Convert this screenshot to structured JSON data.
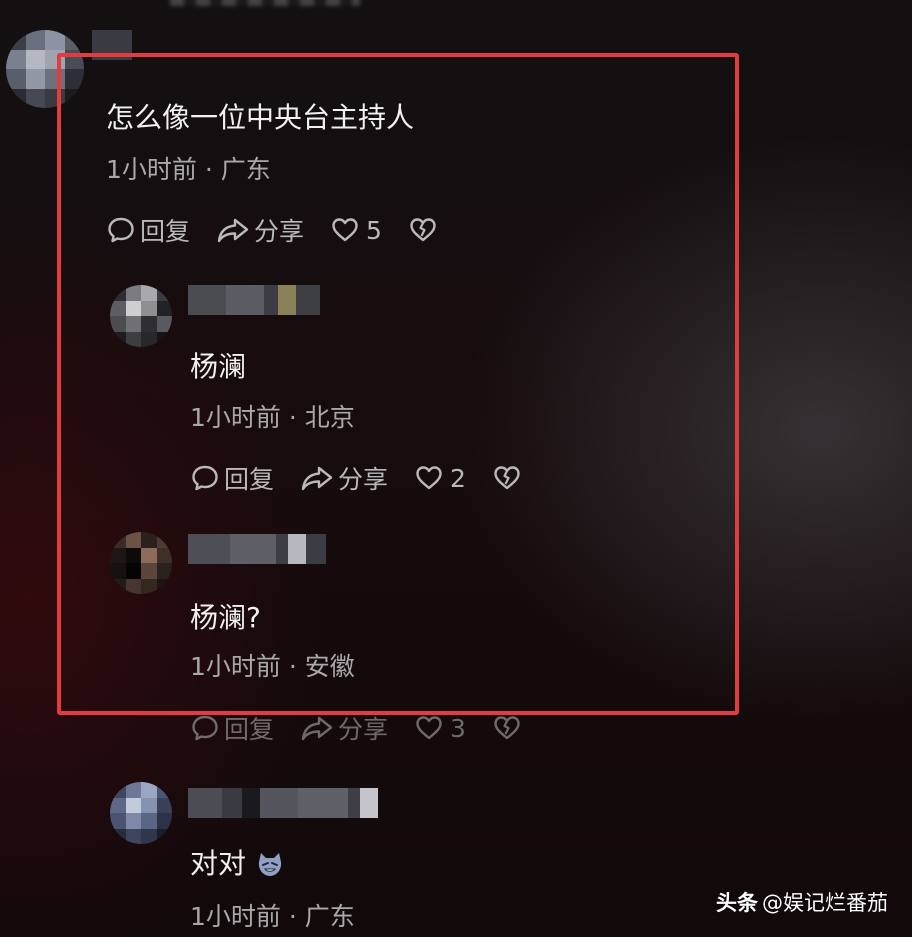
{
  "comments": [
    {
      "text": "怎么像一位中央台主持人",
      "meta": "1小时前 · 广东",
      "reply_label": "回复",
      "share_label": "分享",
      "likes": "5"
    },
    {
      "text": "杨澜",
      "meta": "1小时前 · 北京",
      "reply_label": "回复",
      "share_label": "分享",
      "likes": "2"
    },
    {
      "text": "杨澜?",
      "meta": "1小时前 · 安徽",
      "reply_label": "回复",
      "share_label": "分享",
      "likes": "3"
    },
    {
      "text": "对对",
      "meta": "1小时前 · 广东"
    }
  ],
  "watermark": {
    "platform": "头条",
    "account": "@娱记烂番茄"
  },
  "colors": {
    "highlight_border": "#e23b40",
    "background": "#150b0d",
    "meta_text": "#a9a9a9"
  },
  "icons": [
    "reply-bubble-icon",
    "share-arrow-icon",
    "heart-icon",
    "broken-heart-icon",
    "laughing-emoji-icon"
  ]
}
